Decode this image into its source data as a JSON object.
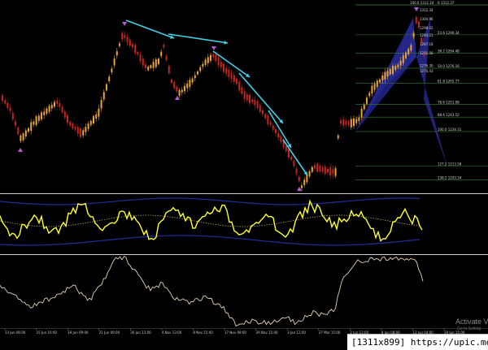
{
  "watermark": {
    "title": "Activate V",
    "subtitle": "Go to Setting"
  },
  "caption": "[1311x899] https://upic.me/",
  "colors": {
    "background": "#000000",
    "price_up": "#e8a23a",
    "price_down": "#c2261f",
    "trend_arrow": "#3fd2e8",
    "oscillator": "#ffff33",
    "envelope": "#1f2f9a",
    "envelope_mid": "#c0c060",
    "lower_line": "#e6d2b0",
    "pattern_fill": "#2c2ea0",
    "fib_line": "#2f6b2f",
    "marker": "#b45cd6"
  },
  "time_labels": [
    "13 Jun 06:00",
    "15 Jun 10:00",
    "19 Jun 09:00",
    "21 Jun 09:00",
    "26 Jun 13:00",
    "4 Nov 13:00",
    "8 Nov 15:00",
    "17 Nov 09:00",
    "29 Nov 15:00",
    "3 Jan 12:00",
    "27 Mar 15:00",
    "2 Jun 13:00",
    "8 Jun 08:00",
    "13 Jun 04:00",
    "19 Jun 15:00"
  ],
  "fib_levels": [
    {
      "label": "100.0 1312.34",
      "ratio": 1.0
    },
    {
      "label": "0 1312.37",
      "ratio": 1.0
    },
    {
      "label": "23.6 1296.34",
      "ratio": 0.764
    },
    {
      "label": "38.2 1284.48",
      "ratio": 0.618
    },
    {
      "label": "50.0 1276.16",
      "ratio": 0.5
    },
    {
      "label": "61.8 1265.77",
      "ratio": 0.382
    },
    {
      "label": "78.6 1251.08",
      "ratio": 0.214
    },
    {
      "label": "88.6 1243.52",
      "ratio": 0.114
    },
    {
      "label": "100.0 1234.31",
      "ratio": 0.0
    },
    {
      "label": "127.2 1213.58",
      "ratio": -0.272
    },
    {
      "label": "138.2 1203.34",
      "ratio": -0.382
    }
  ],
  "fib_inner_labels": [
    "1312.34",
    "1304.96",
    "1298.02",
    "1293.21",
    "1287.18",
    "1281.56",
    "1276.30",
    "1274.43"
  ],
  "fib_inner_ratios": [
    1.0,
    0.93,
    0.86,
    0.8,
    0.73,
    0.66,
    0.56,
    0.52
  ]
}
